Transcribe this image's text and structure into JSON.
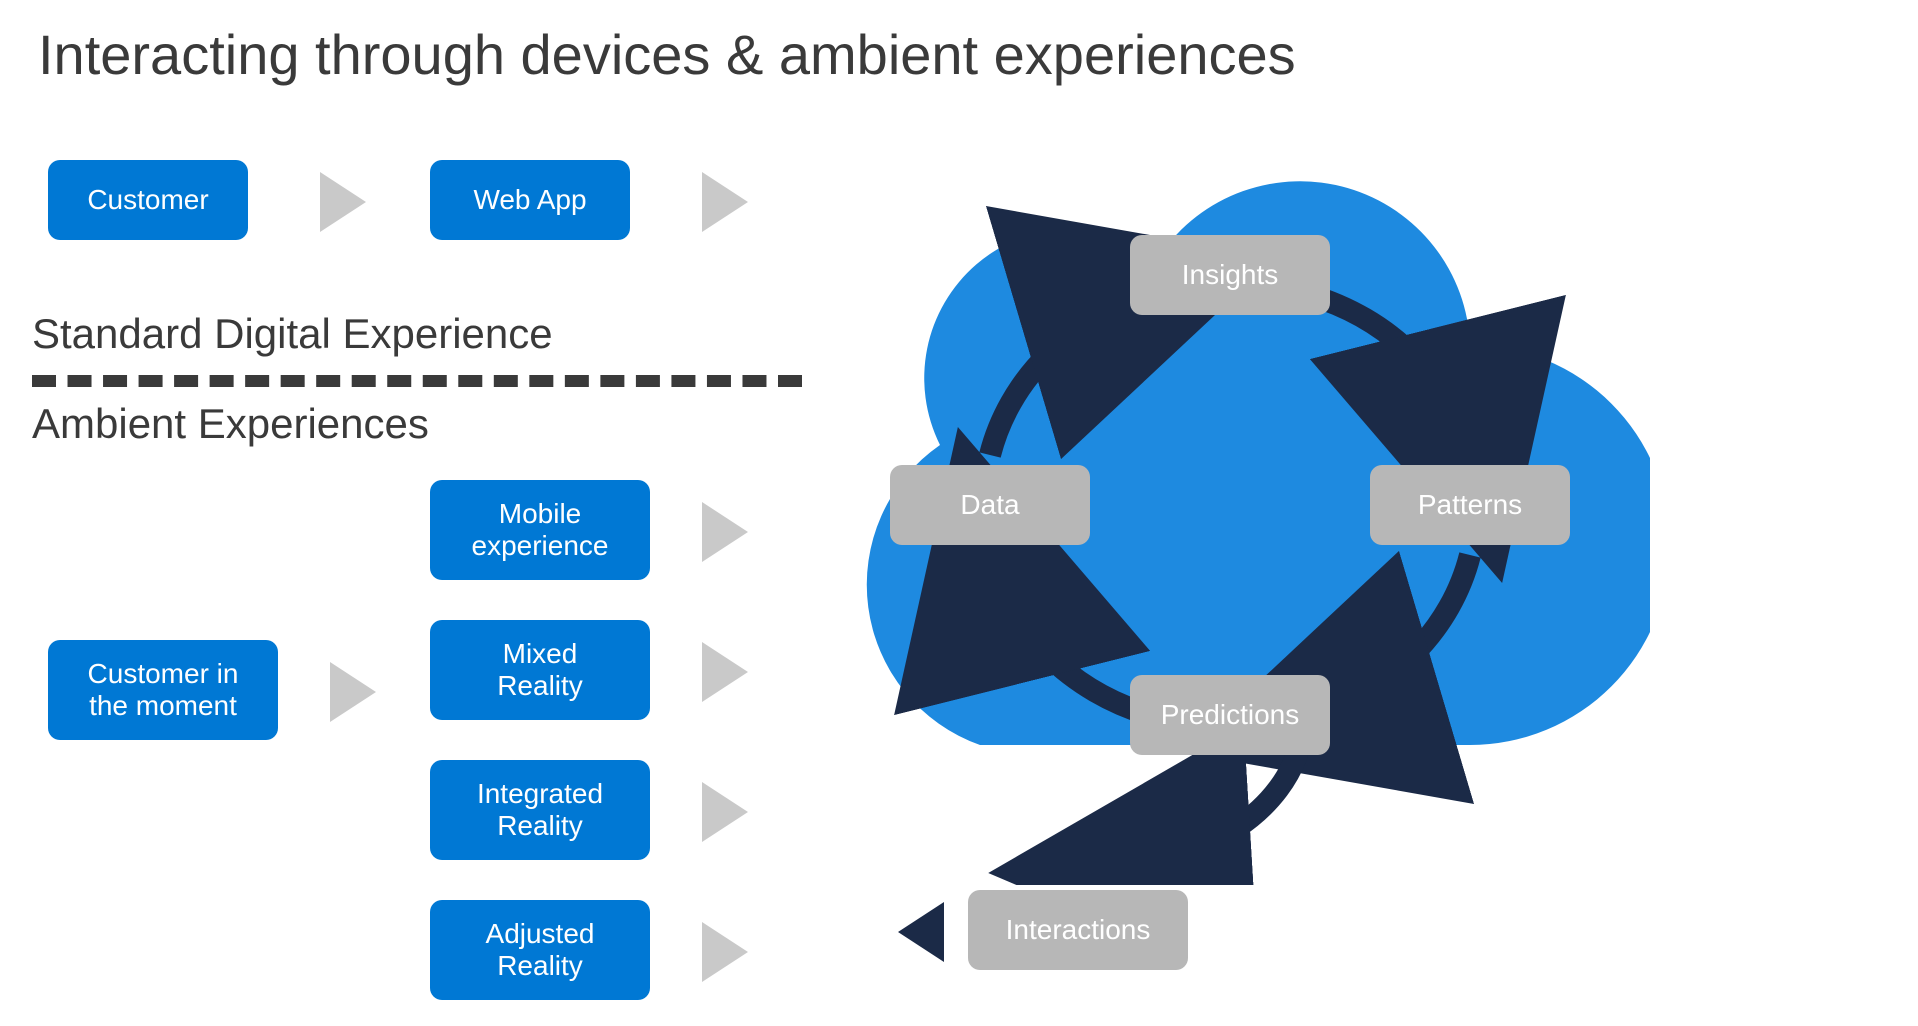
{
  "title": "Interacting through devices & ambient experiences",
  "row1": {
    "customer": "Customer",
    "webapp": "Web App"
  },
  "sections": {
    "standard": "Standard Digital Experience",
    "ambient": "Ambient Experiences"
  },
  "ambient": {
    "customer": "Customer in\nthe moment",
    "items": [
      "Mobile\nexperience",
      "Mixed\nReality",
      "Integrated\nReality",
      "Adjusted\nReality"
    ]
  },
  "cloud": {
    "nodes": {
      "insights": "Insights",
      "patterns": "Patterns",
      "predictions": "Predictions",
      "data": "Data"
    },
    "out": "Interactions"
  },
  "colors": {
    "blue": "#0078d4",
    "boxGray": "#b7b7b7",
    "arrowGray": "#c9c9c9",
    "navy": "#1b2a47",
    "cloud": "#1e8ae0"
  }
}
